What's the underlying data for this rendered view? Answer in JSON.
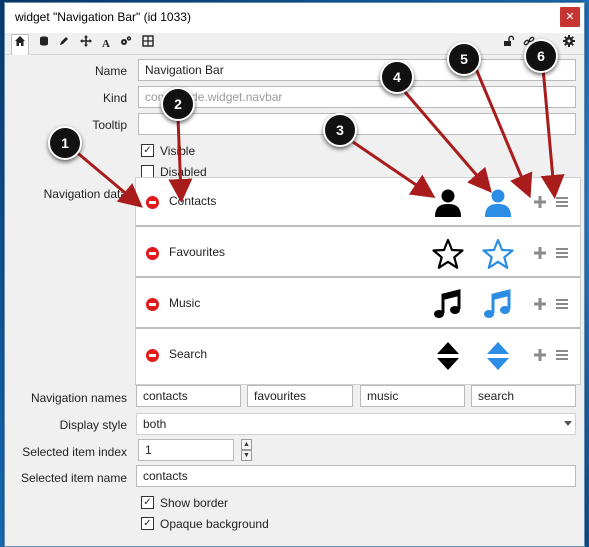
{
  "window": {
    "title": "widget \"Navigation Bar\" (id 1033)",
    "close_label": "✕"
  },
  "form": {
    "name_label": "Name",
    "name_value": "Navigation Bar",
    "kind_label": "Kind",
    "kind_value": "com...node.widget.navbar",
    "tooltip_label": "Tooltip",
    "tooltip_value": "",
    "visible_label": "Visible",
    "disabled_label": "Disabled",
    "navdata_label": "Navigation data",
    "navnames_label": "Navigation names",
    "navnames": [
      "contacts",
      "favourites",
      "music",
      "search"
    ],
    "displaystyle_label": "Display style",
    "displaystyle_value": "both",
    "selindex_label": "Selected item index",
    "selindex_value": "1",
    "selname_label": "Selected item name",
    "selname_value": "contacts",
    "showborder_label": "Show border",
    "opaque_label": "Opaque background"
  },
  "nav_items": [
    {
      "label": "Contacts",
      "icon": "person-icon"
    },
    {
      "label": "Favourites",
      "icon": "star-icon"
    },
    {
      "label": "Music",
      "icon": "music-note-icon"
    },
    {
      "label": "Search",
      "icon": "sort-arrows-icon"
    }
  ],
  "callouts": [
    "1",
    "2",
    "3",
    "4",
    "5",
    "6"
  ],
  "colors": {
    "accent_blue": "#2b8de3",
    "callout_arrow": "#a81c1c",
    "remove_red": "#e21a1a"
  }
}
